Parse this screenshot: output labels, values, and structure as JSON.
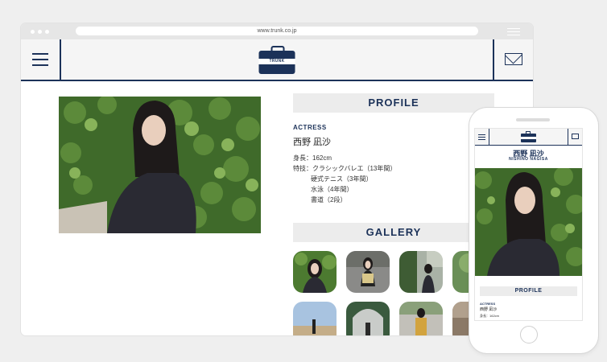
{
  "browser": {
    "url": "www.trunk.co.jp"
  },
  "site": {
    "logo_text": "TRUNK"
  },
  "profile": {
    "section_title": "PROFILE",
    "category": "ACTRESS",
    "name_ja": "西野 凪沙",
    "name_en": "NISHINO NAGISA",
    "height": "身長：162cm",
    "skills_label": "特技：クラシックバレエ（13年間）",
    "skills_more": [
      "硬式テニス（3年間）",
      "水泳（4年間）",
      "書道（2段）"
    ]
  },
  "gallery": {
    "section_title": "GALLERY"
  },
  "colors": {
    "brand_navy": "#1c3259",
    "section_bg": "#ececec",
    "page_bg": "#efefef"
  }
}
